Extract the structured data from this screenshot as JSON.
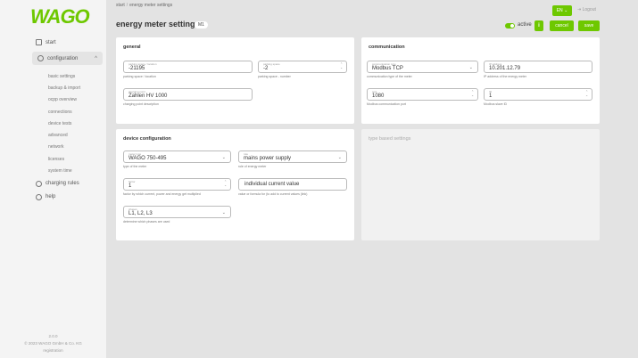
{
  "brand": {
    "logo_text": "WAGO",
    "accent": "#6ec800"
  },
  "breadcrumb": {
    "root": "start",
    "separator": "/",
    "current": "energy meter settings"
  },
  "header": {
    "title": "energy meter settings",
    "badge": "M1",
    "lang": "EN",
    "logout": "Logout",
    "active_label": "active",
    "info": "i",
    "cancel": "cancel",
    "save": "save"
  },
  "sidebar": {
    "start": "start",
    "configuration": "configuration",
    "sub_items": [
      "basic settings",
      "backup & import",
      "ocpp overview",
      "connections",
      "device tests",
      "advanced",
      "network",
      "licenses",
      "system time"
    ],
    "charging_rules": "charging rules",
    "help": "help",
    "footer": [
      "2.0.0",
      "© 2023 WAGO GmbH & Co. KG",
      "registration"
    ]
  },
  "general": {
    "title": "general",
    "parking_location": {
      "label": "parking space / location",
      "value": "-21195",
      "hint": "parking space / location"
    },
    "parking_number": {
      "label": "parking space",
      "value": "-2",
      "hint": "parking space - number"
    },
    "description": {
      "label": "charging point",
      "value": "Zahlen HV 1000",
      "hint": "charging point description"
    }
  },
  "communication": {
    "title": "communication",
    "type": {
      "label": "communication type",
      "value": "Modbus TCP",
      "hint": "communication type of the meter"
    },
    "ip": {
      "label": "IP address",
      "value": "10.201.12.79",
      "hint": "IP address of the energy meter"
    },
    "port": {
      "label": "port",
      "value": "1080",
      "hint": "Modbus communication port"
    },
    "slave": {
      "label": "ID",
      "value": "1",
      "hint": "Modbus slave ID"
    }
  },
  "device": {
    "title": "device configuration",
    "meter_type": {
      "label": "meter type",
      "value": "WAGO 750-495",
      "hint": "type of the meter"
    },
    "role": {
      "label": "role",
      "value": "mains power supply",
      "hint": "role of energy meter"
    },
    "factor": {
      "label": "factor",
      "value": "1",
      "hint": "factor by which current, power and energy get multiplied"
    },
    "current": {
      "value": "individual current value",
      "hint": "value or formula for (to add to current values (link)"
    },
    "phases": {
      "label": "phases",
      "value": "L1, L2, L3",
      "hint": "determine which phases are used"
    }
  },
  "type_based": {
    "title": "type based settings"
  }
}
